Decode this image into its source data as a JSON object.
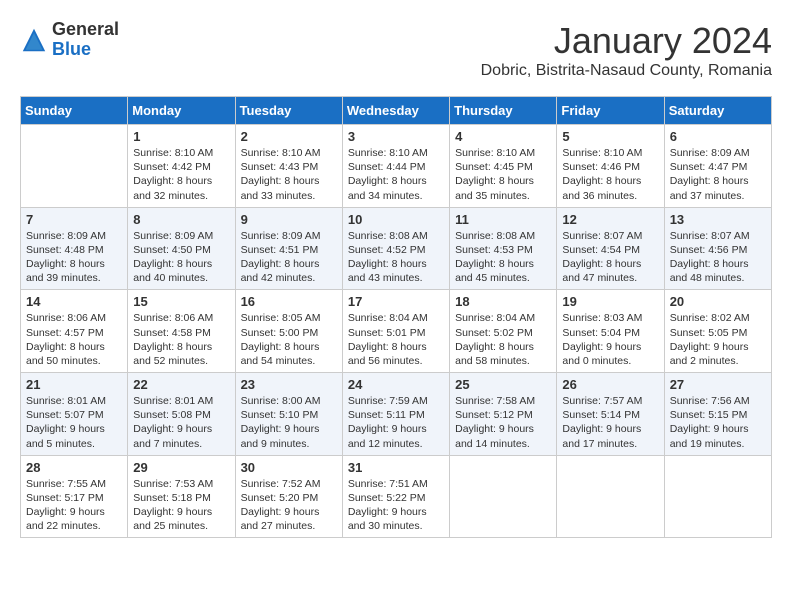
{
  "logo": {
    "general": "General",
    "blue": "Blue"
  },
  "header": {
    "month": "January 2024",
    "location": "Dobric, Bistrita-Nasaud County, Romania"
  },
  "weekdays": [
    "Sunday",
    "Monday",
    "Tuesday",
    "Wednesday",
    "Thursday",
    "Friday",
    "Saturday"
  ],
  "weeks": [
    [
      {
        "day": "",
        "info": ""
      },
      {
        "day": "1",
        "info": "Sunrise: 8:10 AM\nSunset: 4:42 PM\nDaylight: 8 hours\nand 32 minutes."
      },
      {
        "day": "2",
        "info": "Sunrise: 8:10 AM\nSunset: 4:43 PM\nDaylight: 8 hours\nand 33 minutes."
      },
      {
        "day": "3",
        "info": "Sunrise: 8:10 AM\nSunset: 4:44 PM\nDaylight: 8 hours\nand 34 minutes."
      },
      {
        "day": "4",
        "info": "Sunrise: 8:10 AM\nSunset: 4:45 PM\nDaylight: 8 hours\nand 35 minutes."
      },
      {
        "day": "5",
        "info": "Sunrise: 8:10 AM\nSunset: 4:46 PM\nDaylight: 8 hours\nand 36 minutes."
      },
      {
        "day": "6",
        "info": "Sunrise: 8:09 AM\nSunset: 4:47 PM\nDaylight: 8 hours\nand 37 minutes."
      }
    ],
    [
      {
        "day": "7",
        "info": "Sunrise: 8:09 AM\nSunset: 4:48 PM\nDaylight: 8 hours\nand 39 minutes."
      },
      {
        "day": "8",
        "info": "Sunrise: 8:09 AM\nSunset: 4:50 PM\nDaylight: 8 hours\nand 40 minutes."
      },
      {
        "day": "9",
        "info": "Sunrise: 8:09 AM\nSunset: 4:51 PM\nDaylight: 8 hours\nand 42 minutes."
      },
      {
        "day": "10",
        "info": "Sunrise: 8:08 AM\nSunset: 4:52 PM\nDaylight: 8 hours\nand 43 minutes."
      },
      {
        "day": "11",
        "info": "Sunrise: 8:08 AM\nSunset: 4:53 PM\nDaylight: 8 hours\nand 45 minutes."
      },
      {
        "day": "12",
        "info": "Sunrise: 8:07 AM\nSunset: 4:54 PM\nDaylight: 8 hours\nand 47 minutes."
      },
      {
        "day": "13",
        "info": "Sunrise: 8:07 AM\nSunset: 4:56 PM\nDaylight: 8 hours\nand 48 minutes."
      }
    ],
    [
      {
        "day": "14",
        "info": "Sunrise: 8:06 AM\nSunset: 4:57 PM\nDaylight: 8 hours\nand 50 minutes."
      },
      {
        "day": "15",
        "info": "Sunrise: 8:06 AM\nSunset: 4:58 PM\nDaylight: 8 hours\nand 52 minutes."
      },
      {
        "day": "16",
        "info": "Sunrise: 8:05 AM\nSunset: 5:00 PM\nDaylight: 8 hours\nand 54 minutes."
      },
      {
        "day": "17",
        "info": "Sunrise: 8:04 AM\nSunset: 5:01 PM\nDaylight: 8 hours\nand 56 minutes."
      },
      {
        "day": "18",
        "info": "Sunrise: 8:04 AM\nSunset: 5:02 PM\nDaylight: 8 hours\nand 58 minutes."
      },
      {
        "day": "19",
        "info": "Sunrise: 8:03 AM\nSunset: 5:04 PM\nDaylight: 9 hours\nand 0 minutes."
      },
      {
        "day": "20",
        "info": "Sunrise: 8:02 AM\nSunset: 5:05 PM\nDaylight: 9 hours\nand 2 minutes."
      }
    ],
    [
      {
        "day": "21",
        "info": "Sunrise: 8:01 AM\nSunset: 5:07 PM\nDaylight: 9 hours\nand 5 minutes."
      },
      {
        "day": "22",
        "info": "Sunrise: 8:01 AM\nSunset: 5:08 PM\nDaylight: 9 hours\nand 7 minutes."
      },
      {
        "day": "23",
        "info": "Sunrise: 8:00 AM\nSunset: 5:10 PM\nDaylight: 9 hours\nand 9 minutes."
      },
      {
        "day": "24",
        "info": "Sunrise: 7:59 AM\nSunset: 5:11 PM\nDaylight: 9 hours\nand 12 minutes."
      },
      {
        "day": "25",
        "info": "Sunrise: 7:58 AM\nSunset: 5:12 PM\nDaylight: 9 hours\nand 14 minutes."
      },
      {
        "day": "26",
        "info": "Sunrise: 7:57 AM\nSunset: 5:14 PM\nDaylight: 9 hours\nand 17 minutes."
      },
      {
        "day": "27",
        "info": "Sunrise: 7:56 AM\nSunset: 5:15 PM\nDaylight: 9 hours\nand 19 minutes."
      }
    ],
    [
      {
        "day": "28",
        "info": "Sunrise: 7:55 AM\nSunset: 5:17 PM\nDaylight: 9 hours\nand 22 minutes."
      },
      {
        "day": "29",
        "info": "Sunrise: 7:53 AM\nSunset: 5:18 PM\nDaylight: 9 hours\nand 25 minutes."
      },
      {
        "day": "30",
        "info": "Sunrise: 7:52 AM\nSunset: 5:20 PM\nDaylight: 9 hours\nand 27 minutes."
      },
      {
        "day": "31",
        "info": "Sunrise: 7:51 AM\nSunset: 5:22 PM\nDaylight: 9 hours\nand 30 minutes."
      },
      {
        "day": "",
        "info": ""
      },
      {
        "day": "",
        "info": ""
      },
      {
        "day": "",
        "info": ""
      }
    ]
  ]
}
